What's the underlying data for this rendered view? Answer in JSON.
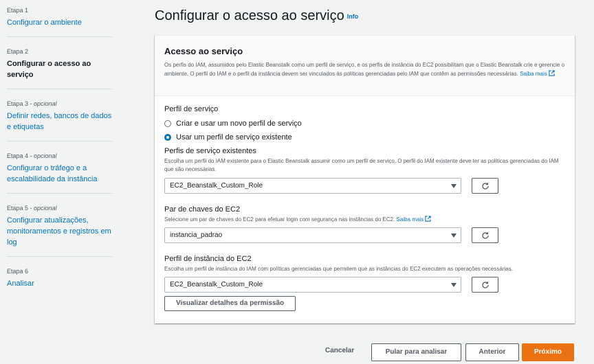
{
  "steps": [
    {
      "num": "Etapa 1",
      "optional": "",
      "label": "Configurar o ambiente",
      "current": false
    },
    {
      "num": "Etapa 2",
      "optional": "",
      "label": "Configurar o acesso ao serviço",
      "current": true
    },
    {
      "num": "Etapa 3",
      "optional": "opcional",
      "label": "Definir redes, bancos de dados e etiquetas",
      "current": false
    },
    {
      "num": "Etapa 4",
      "optional": "opcional",
      "label": "Configurar o tráfego e a escalabilidade da instância",
      "current": false
    },
    {
      "num": "Etapa 5",
      "optional": "opcional",
      "label": "Configurar atualizações, monitoramentos e registros em log",
      "current": false
    },
    {
      "num": "Etapa 6",
      "optional": "",
      "label": "Analisar",
      "current": false
    }
  ],
  "header": {
    "title": "Configurar o acesso ao serviço",
    "info": "Info"
  },
  "section": {
    "title": "Acesso ao serviço",
    "description": "Os perfis do IAM, assumidos pelo Elastic Beanstalk como um perfil de serviço, e os perfis de instância do EC2 possibilitam que o Elastic Beanstalk crie e gerencie o ambiente. O perfil do IAM e o perfil da instância devem ser vinculados às políticas gerenciadas pelo IAM que contêm as permissões necessárias.",
    "learn_more": "Saiba mais"
  },
  "service_role": {
    "label": "Perfil de serviço",
    "options": [
      {
        "label": "Criar e usar um novo perfil de serviço",
        "selected": false
      },
      {
        "label": "Usar um perfil de serviço existente",
        "selected": true
      }
    ]
  },
  "existing_roles": {
    "label": "Perfis de serviço existentes",
    "description": "Escolha um perfil do IAM existente para o Elastic Beanstalk assumir como um perfil de serviço. O perfil do IAM existente deve ter as políticas gerenciadas do IAM que são necessárias.",
    "value": "EC2_Beanstalk_Custom_Role"
  },
  "key_pair": {
    "label": "Par de chaves do EC2",
    "description": "Selecione um par de chaves do EC2 para efetuar login com segurança nas instâncias do EC2.",
    "learn_more": "Saiba mais",
    "value": "instancia_padrao"
  },
  "instance_profile": {
    "label": "Perfil de instância do EC2",
    "description": "Escolha um perfil de instância do IAM com políticas gerenciadas que permitem que as instâncias do EC2 executem as operações necessárias.",
    "value": "EC2_Beanstalk_Custom_Role",
    "view_button": "Visualizar detalhes da permissão"
  },
  "footer": {
    "cancel": "Cancelar",
    "skip": "Pular para analisar",
    "previous": "Anterior",
    "next": "Próximo"
  },
  "colors": {
    "accent": "#0073bb",
    "primary": "#ec7211"
  }
}
